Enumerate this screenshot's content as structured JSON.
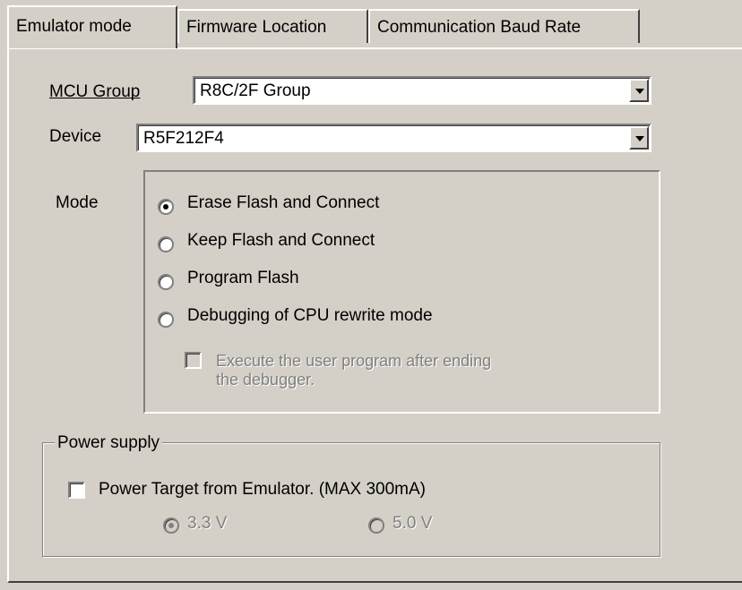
{
  "tabs": [
    "Emulator mode",
    "Firmware Location",
    "Communication Baud Rate"
  ],
  "mcu_group": {
    "label": "MCU Group",
    "value": "R8C/2F Group"
  },
  "device": {
    "label": "Device",
    "value": "R5F212F4"
  },
  "mode": {
    "label": "Mode",
    "options": [
      {
        "label": "Erase Flash and Connect",
        "selected": true
      },
      {
        "label": "Keep Flash and Connect",
        "selected": false
      },
      {
        "label": "Program Flash",
        "selected": false
      },
      {
        "label": "Debugging of CPU rewrite mode",
        "selected": false
      }
    ],
    "execute_after_line1": "Execute the user program after ending",
    "execute_after_line2": "the debugger."
  },
  "power_supply": {
    "legend": "Power supply",
    "power_target_label": "Power Target from Emulator. (MAX 300mA)",
    "v33": "3.3 V",
    "v50": "5.0 V"
  }
}
